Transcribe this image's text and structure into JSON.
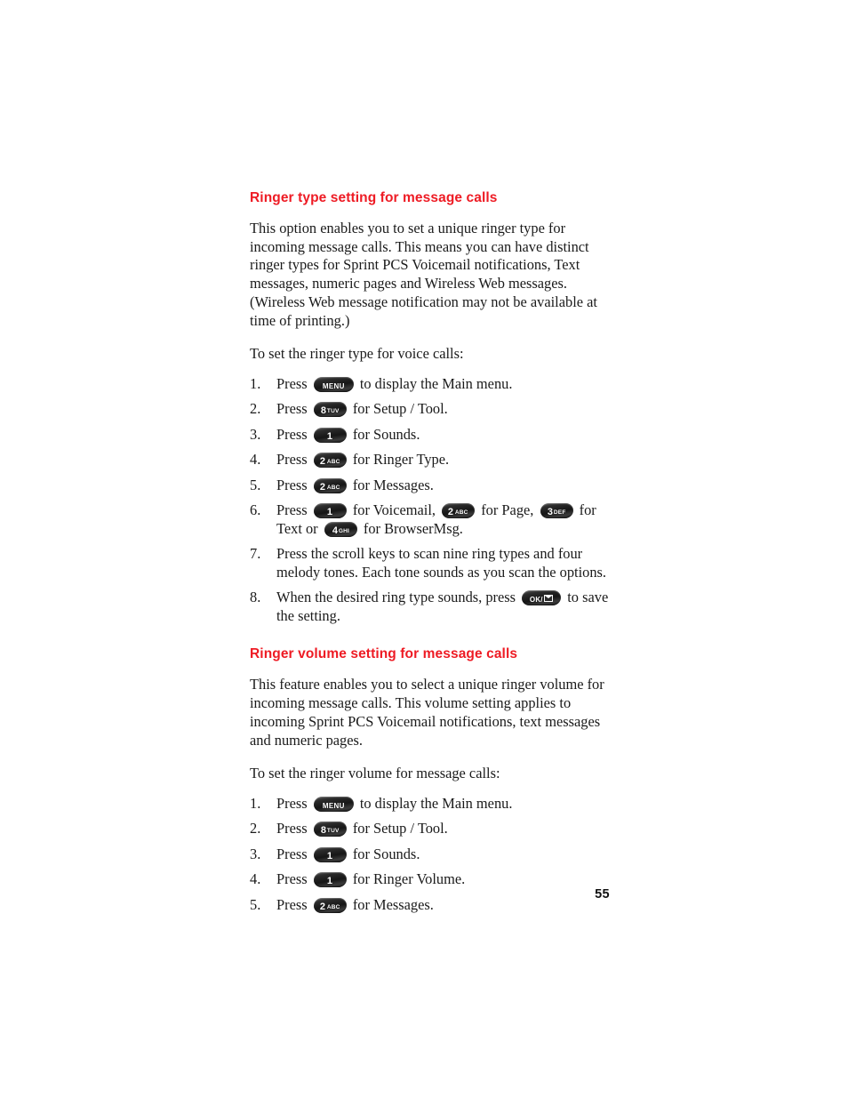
{
  "page": {
    "number": "55",
    "heading_color": "#ee1b24",
    "text_color": "#1a1a1a",
    "background": "#ffffff"
  },
  "sections": [
    {
      "heading": "Ringer type setting for message calls",
      "paragraphs": [
        "This option enables you to set a unique ringer type for incoming message calls. This means you can have distinct ringer types for Sprint PCS Voicemail notifications, Text messages, numeric pages and Wireless Web messages. (Wireless Web message notification may not be available at time of printing.)"
      ],
      "lead_in": "To set the ringer type for voice calls:",
      "steps": [
        {
          "num": "1.",
          "parts": [
            {
              "type": "text",
              "value": "Press"
            },
            {
              "type": "key",
              "label": "MENU",
              "style": "word"
            },
            {
              "type": "text",
              "value": "to display the Main menu."
            }
          ]
        },
        {
          "num": "2.",
          "parts": [
            {
              "type": "text",
              "value": "Press"
            },
            {
              "type": "key",
              "digit": "8",
              "letters": "TUV",
              "style": "digit"
            },
            {
              "type": "text",
              "value": "for Setup / Tool."
            }
          ]
        },
        {
          "num": "3.",
          "parts": [
            {
              "type": "text",
              "value": "Press"
            },
            {
              "type": "key",
              "digit": "1",
              "letters": "",
              "style": "digit"
            },
            {
              "type": "text",
              "value": "for Sounds."
            }
          ]
        },
        {
          "num": "4.",
          "parts": [
            {
              "type": "text",
              "value": "Press"
            },
            {
              "type": "key",
              "digit": "2",
              "letters": "ABC",
              "style": "digit"
            },
            {
              "type": "text",
              "value": "for Ringer Type."
            }
          ]
        },
        {
          "num": "5.",
          "parts": [
            {
              "type": "text",
              "value": "Press"
            },
            {
              "type": "key",
              "digit": "2",
              "letters": "ABC",
              "style": "digit"
            },
            {
              "type": "text",
              "value": "for Messages."
            }
          ]
        },
        {
          "num": "6.",
          "parts": [
            {
              "type": "text",
              "value": "Press"
            },
            {
              "type": "key",
              "digit": "1",
              "letters": "",
              "style": "digit"
            },
            {
              "type": "text",
              "value": "for Voicemail,"
            },
            {
              "type": "key",
              "digit": "2",
              "letters": "ABC",
              "style": "digit"
            },
            {
              "type": "text",
              "value": "for Page,"
            },
            {
              "type": "key",
              "digit": "3",
              "letters": "DEF",
              "style": "digit"
            },
            {
              "type": "text",
              "value": "for Text or"
            },
            {
              "type": "key",
              "digit": "4",
              "letters": "GHI",
              "style": "digit"
            },
            {
              "type": "text",
              "value": "for BrowserMsg."
            }
          ]
        },
        {
          "num": "7.",
          "parts": [
            {
              "type": "text",
              "value": "Press the scroll keys to scan nine ring types and four melody tones. Each tone sounds as you scan the options."
            }
          ]
        },
        {
          "num": "8.",
          "parts": [
            {
              "type": "text",
              "value": "When the desired ring type sounds, press"
            },
            {
              "type": "key",
              "label": "OK/",
              "style": "ok"
            },
            {
              "type": "text",
              "value": "to save the setting."
            }
          ]
        }
      ]
    },
    {
      "heading": "Ringer volume setting for message calls",
      "paragraphs": [
        "This feature enables you to select a unique ringer volume for incoming message calls. This volume setting applies to incoming Sprint PCS Voicemail notifications, text messages and numeric pages."
      ],
      "lead_in": "To set the ringer volume for message calls:",
      "steps": [
        {
          "num": "1.",
          "parts": [
            {
              "type": "text",
              "value": "Press"
            },
            {
              "type": "key",
              "label": "MENU",
              "style": "word"
            },
            {
              "type": "text",
              "value": "to display the Main menu."
            }
          ]
        },
        {
          "num": "2.",
          "parts": [
            {
              "type": "text",
              "value": "Press"
            },
            {
              "type": "key",
              "digit": "8",
              "letters": "TUV",
              "style": "digit"
            },
            {
              "type": "text",
              "value": "for Setup / Tool."
            }
          ]
        },
        {
          "num": "3.",
          "parts": [
            {
              "type": "text",
              "value": "Press"
            },
            {
              "type": "key",
              "digit": "1",
              "letters": "",
              "style": "digit"
            },
            {
              "type": "text",
              "value": "for Sounds."
            }
          ]
        },
        {
          "num": "4.",
          "parts": [
            {
              "type": "text",
              "value": "Press"
            },
            {
              "type": "key",
              "digit": "1",
              "letters": "",
              "style": "digit"
            },
            {
              "type": "text",
              "value": "for Ringer Volume."
            }
          ]
        },
        {
          "num": "5.",
          "parts": [
            {
              "type": "text",
              "value": "Press"
            },
            {
              "type": "key",
              "digit": "2",
              "letters": "ABC",
              "style": "digit"
            },
            {
              "type": "text",
              "value": "for Messages."
            }
          ]
        }
      ]
    }
  ]
}
